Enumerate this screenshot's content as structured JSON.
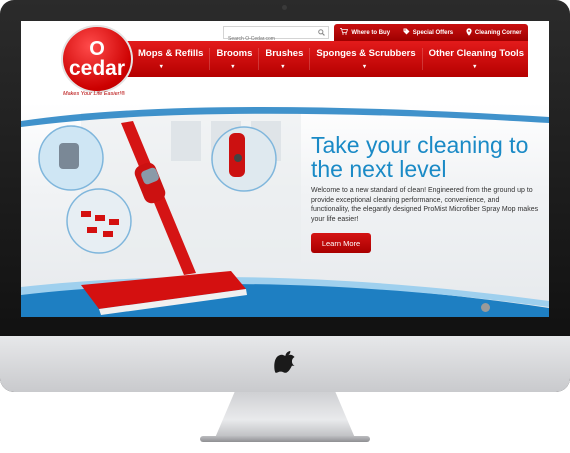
{
  "brand": {
    "logo_line1": "O",
    "logo_line2": "cedar",
    "tagline": "Makes Your Life Easier!®",
    "color": "#cc0000"
  },
  "search": {
    "placeholder": "Search O-Cedar.com",
    "icon": "search-icon"
  },
  "utility_nav": [
    {
      "label": "Where to Buy",
      "icon": "cart-icon"
    },
    {
      "label": "Special Offers",
      "icon": "tag-icon"
    },
    {
      "label": "Cleaning Corner",
      "icon": "location-pin-icon"
    }
  ],
  "main_nav": [
    {
      "label": "Mops & Refills"
    },
    {
      "label": "Brooms"
    },
    {
      "label": "Brushes"
    },
    {
      "label": "Sponges & Scrubbers"
    },
    {
      "label": "Other Cleaning Tools"
    }
  ],
  "hero": {
    "title": "Take your cleaning to the next level",
    "body": "Welcome to a new standard of clean! Engineered from the ground up to provide exceptional cleaning performance, convenience, and functionality, the elegantly designed ProMist Microfiber Spray Mop makes your life easier!",
    "cta_label": "Learn More",
    "title_color": "#1a8ac6",
    "cta_color": "#c00000"
  },
  "slider": {
    "active_index": 1,
    "count": 1
  }
}
